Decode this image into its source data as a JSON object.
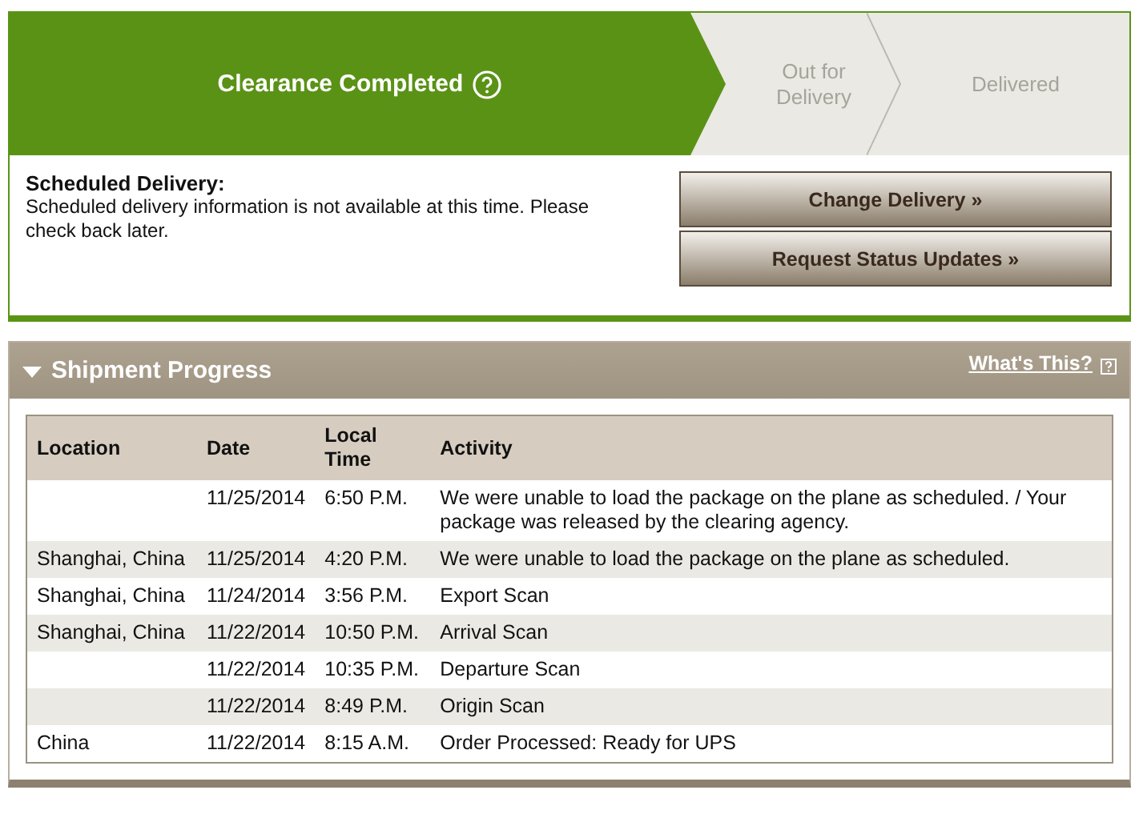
{
  "progress_steps": [
    {
      "label": "Clearance Completed",
      "selected": true
    },
    {
      "label": "Out for Delivery",
      "selected": false
    },
    {
      "label": "Delivered",
      "selected": false
    }
  ],
  "scheduled_delivery": {
    "heading": "Scheduled Delivery:",
    "message": "Scheduled delivery information is not available at this time. Please check back later."
  },
  "buttons": [
    "Change Delivery »",
    "Request Status Updates »"
  ],
  "shipment_progress": {
    "title": "Shipment Progress",
    "expanded": true,
    "help_link": "What's This?",
    "table": {
      "columns": [
        "Location",
        "Date",
        "Local Time",
        "Activity"
      ],
      "rows": [
        [
          "",
          "11/25/2014",
          "6:50 P.M.",
          "We were unable to load the package on the plane as scheduled. / Your package was released by the clearing agency."
        ],
        [
          "Shanghai, China",
          "11/25/2014",
          "4:20 P.M.",
          "We were unable to load the package on the plane as scheduled."
        ],
        [
          "Shanghai, China",
          "11/24/2014",
          "3:56 P.M.",
          "Export Scan"
        ],
        [
          "Shanghai, China",
          "11/22/2014",
          "10:50 P.M.",
          "Arrival Scan"
        ],
        [
          "",
          "11/22/2014",
          "10:35 P.M.",
          "Departure Scan"
        ],
        [
          "",
          "11/22/2014",
          "8:49 P.M.",
          "Origin Scan"
        ],
        [
          "China",
          "11/22/2014",
          "8:15 A.M.",
          "Order Processed: Ready for UPS"
        ]
      ]
    }
  }
}
